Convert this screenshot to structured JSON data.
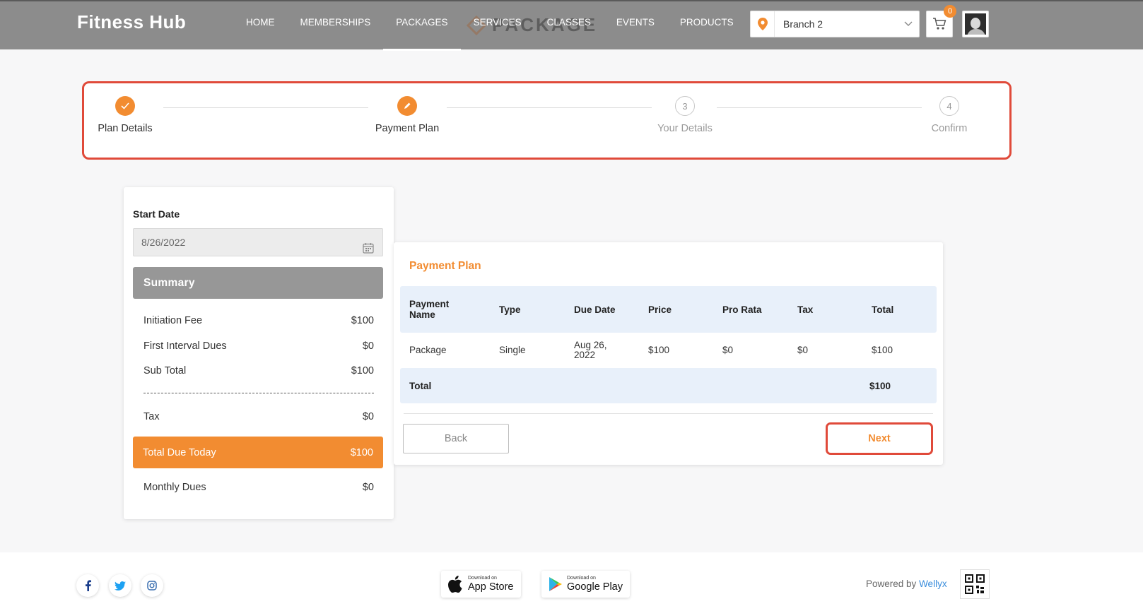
{
  "header": {
    "brand": "Fitness Hub",
    "nav": [
      {
        "label": "HOME",
        "active": false
      },
      {
        "label": "MEMBERSHIPS",
        "active": false
      },
      {
        "label": "PACKAGES",
        "active": true
      },
      {
        "label": "SERVICES",
        "active": false
      },
      {
        "label": "CLASSES",
        "active": false
      },
      {
        "label": "EVENTS",
        "active": false
      },
      {
        "label": "PRODUCTS",
        "active": false
      }
    ],
    "page_banner": "PACKAGE",
    "branch": "Branch 2",
    "cart_count": "0"
  },
  "stepper": {
    "steps": [
      {
        "label": "Plan Details",
        "state": "done",
        "marker": "check-icon"
      },
      {
        "label": "Payment Plan",
        "state": "current",
        "marker": "pencil-icon"
      },
      {
        "label": "Your Details",
        "state": "pending",
        "number": "3"
      },
      {
        "label": "Confirm",
        "state": "pending",
        "number": "4"
      }
    ]
  },
  "left_panel": {
    "start_date_label": "Start Date",
    "start_date_value": "8/26/2022",
    "summary_title": "Summary",
    "rows": [
      {
        "label": "Initiation Fee",
        "value": "$100"
      },
      {
        "label": "First Interval Dues",
        "value": "$0"
      },
      {
        "label": "Sub Total",
        "value": "$100"
      },
      {
        "label": "Tax",
        "value": "$0"
      }
    ],
    "total_due_label": "Total Due Today",
    "total_due_value": "$100",
    "monthly_label": "Monthly Dues",
    "monthly_value": "$0"
  },
  "payment_plan": {
    "title": "Payment Plan",
    "columns": [
      "Payment Name",
      "Type",
      "Due Date",
      "Price",
      "Pro Rata",
      "Tax",
      "Total"
    ],
    "rows": [
      [
        "Package",
        "Single",
        "Aug 26, 2022",
        "$100",
        "$0",
        "$0",
        "$100"
      ]
    ],
    "total_label": "Total",
    "total_value": "$100",
    "back_label": "Back",
    "next_label": "Next"
  },
  "footer": {
    "app_store_small": "Download on",
    "app_store_big": "App Store",
    "google_play_small": "Download on",
    "google_play_big": "Google Play",
    "powered_prefix": "Powered by",
    "powered_brand": "Wellyx"
  },
  "colors": {
    "accent": "#f28c31",
    "header_bg": "#8c8c8c",
    "highlight": "#e04a3a",
    "table_header_bg": "#e8f0fa"
  }
}
